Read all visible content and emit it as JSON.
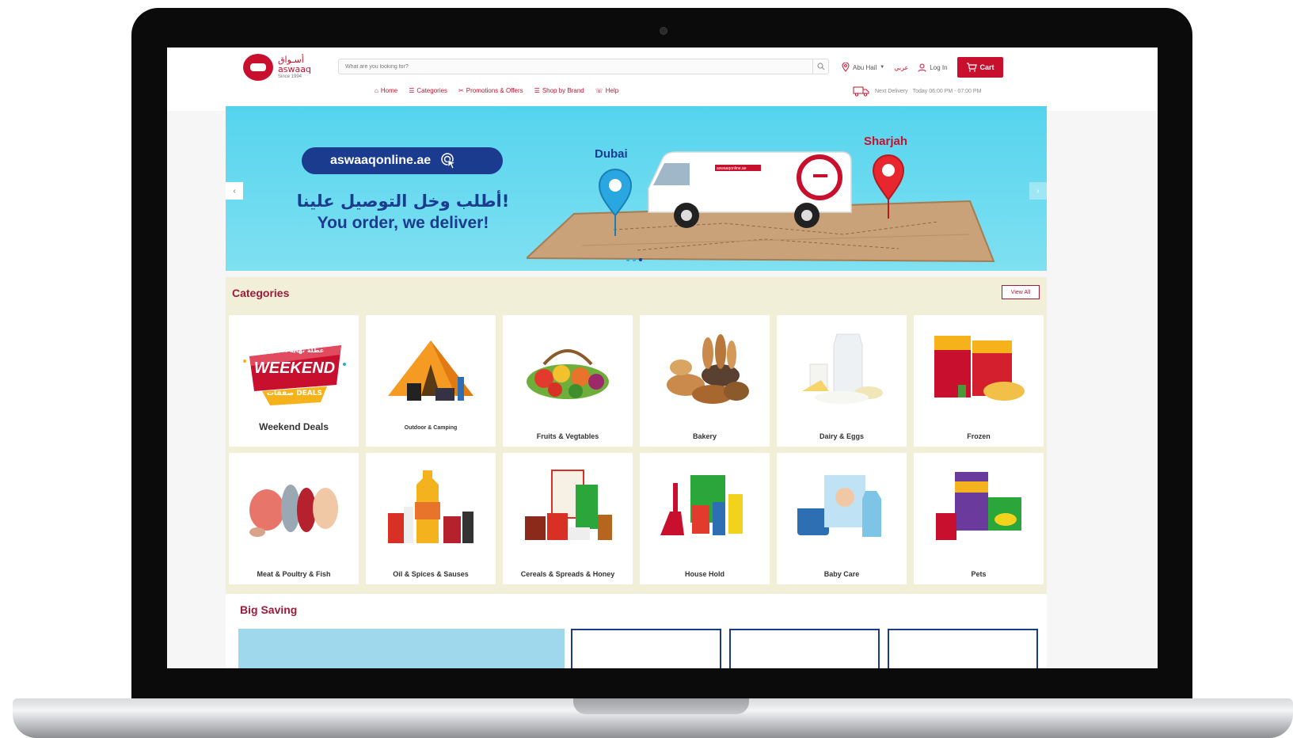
{
  "header": {
    "logo_text": "أسـواق",
    "logo_latin": "aswaaq",
    "logo_sub": "Since 1994",
    "search": {
      "placeholder": "What are you looking for?"
    },
    "location_label": "Abu Hail",
    "language_label": "عربي",
    "login_label": "Log In",
    "cart_label": "Cart",
    "nav": [
      {
        "label": "Home",
        "icon": "home-icon"
      },
      {
        "label": "Categories",
        "icon": "list-icon"
      },
      {
        "label": "Promotions & Offers",
        "icon": "tag-icon"
      },
      {
        "label": "Shop by Brand",
        "icon": "list-icon"
      },
      {
        "label": "Help",
        "icon": "help-icon"
      }
    ],
    "next_delivery_label": "Next Delivery",
    "next_delivery_value": "Today 06:00 PM - 07:00 PM"
  },
  "banner": {
    "url": "aswaaqonline.ae",
    "tagline_ar": "أطلب وخل التوصيل علينا!",
    "tagline_en": "You order, we deliver!",
    "city_left": "Dubai",
    "city_right": "Sharjah",
    "van_text": "aswaaqonline.ae",
    "slide_count": 3,
    "active_slide": 2
  },
  "categories": {
    "title": "Categories",
    "view_all": "View All",
    "weekend_badge_ar": "عطلة نهاية الأسبوع",
    "weekend_badge_en": "WEEKEND",
    "weekend_badge_sub": "صفقات DEALS",
    "items": [
      {
        "label": "Weekend Deals",
        "icon": "weekend-deals-icon"
      },
      {
        "label": "Outdoor & Camping",
        "icon": "tent-icon"
      },
      {
        "label": "Fruits & Vegtables",
        "icon": "fruit-basket-icon"
      },
      {
        "label": "Bakery",
        "icon": "bread-basket-icon"
      },
      {
        "label": "Dairy & Eggs",
        "icon": "dairy-icon"
      },
      {
        "label": "Frozen",
        "icon": "frozen-fries-icon"
      },
      {
        "label": "Meat & Poultry & Fish",
        "icon": "meat-icon"
      },
      {
        "label": "Oil & Spices & Sauses",
        "icon": "oil-bottle-icon"
      },
      {
        "label": "Cereals & Spreads & Honey",
        "icon": "cereal-box-icon"
      },
      {
        "label": "House Hold",
        "icon": "cleaning-icon"
      },
      {
        "label": "Baby Care",
        "icon": "baby-care-icon"
      },
      {
        "label": "Pets",
        "icon": "pet-food-icon"
      }
    ]
  },
  "big_saving": {
    "title": "Big Saving"
  },
  "colors": {
    "brand_red": "#c8102e",
    "brand_navy": "#1b3b8f",
    "banner_cyan": "#55d4ee",
    "categories_bg": "#f2efd9"
  }
}
